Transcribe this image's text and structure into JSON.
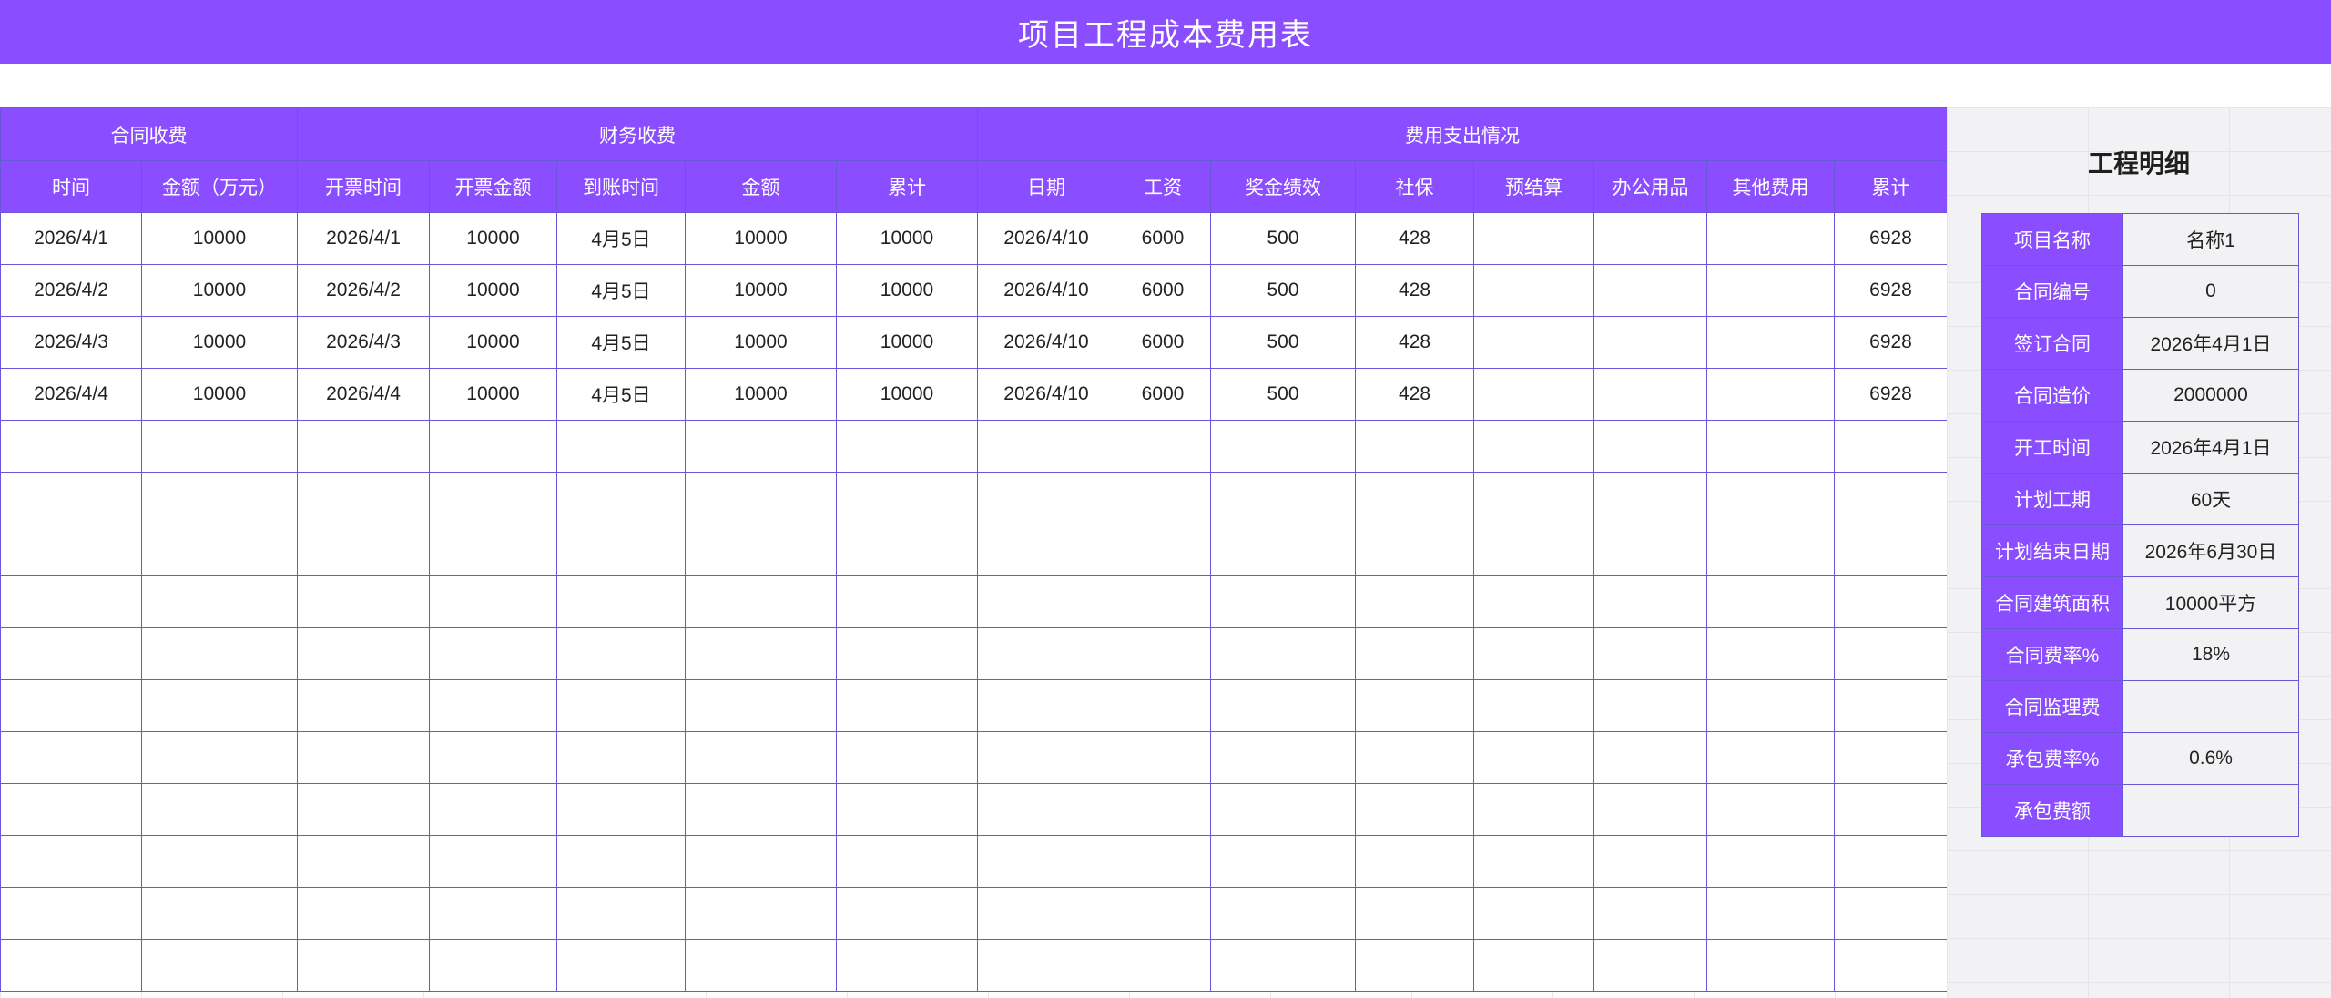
{
  "title": "项目工程成本费用表",
  "groups": {
    "contract": "合同收费",
    "finance": "财务收费",
    "expense": "费用支出情况"
  },
  "columns": [
    "时间",
    "金额（万元）",
    "开票时间",
    "开票金额",
    "到账时间",
    "金额",
    "累计",
    "日期",
    "工资",
    "奖金绩效",
    "社保",
    "预结算",
    "办公用品",
    "其他费用",
    "累计"
  ],
  "rows": [
    [
      "2026/4/1",
      "10000",
      "2026/4/1",
      "10000",
      "4月5日",
      "10000",
      "10000",
      "2026/4/10",
      "6000",
      "500",
      "428",
      "",
      "",
      "",
      "6928"
    ],
    [
      "2026/4/2",
      "10000",
      "2026/4/2",
      "10000",
      "4月5日",
      "10000",
      "10000",
      "2026/4/10",
      "6000",
      "500",
      "428",
      "",
      "",
      "",
      "6928"
    ],
    [
      "2026/4/3",
      "10000",
      "2026/4/3",
      "10000",
      "4月5日",
      "10000",
      "10000",
      "2026/4/10",
      "6000",
      "500",
      "428",
      "",
      "",
      "",
      "6928"
    ],
    [
      "2026/4/4",
      "10000",
      "2026/4/4",
      "10000",
      "4月5日",
      "10000",
      "10000",
      "2026/4/10",
      "6000",
      "500",
      "428",
      "",
      "",
      "",
      "6928"
    ]
  ],
  "empty_row_count": 11,
  "detail": {
    "title": "工程明细",
    "items": [
      {
        "label": "项目名称",
        "value": "名称1"
      },
      {
        "label": "合同编号",
        "value": "0"
      },
      {
        "label": "签订合同",
        "value": "2026年4月1日"
      },
      {
        "label": "合同造价",
        "value": "2000000"
      },
      {
        "label": "开工时间",
        "value": "2026年4月1日"
      },
      {
        "label": "计划工期",
        "value": "60天"
      },
      {
        "label": "计划结束日期",
        "value": "2026年6月30日"
      },
      {
        "label": "合同建筑面积",
        "value": "10000平方"
      },
      {
        "label": "合同费率%",
        "value": "18%"
      },
      {
        "label": "合同监理费",
        "value": ""
      },
      {
        "label": "承包费率%",
        "value": "0.6%"
      },
      {
        "label": "承包费额",
        "value": ""
      }
    ]
  },
  "colors": {
    "accent": "#8a4dff",
    "border": "#6a56d8"
  }
}
